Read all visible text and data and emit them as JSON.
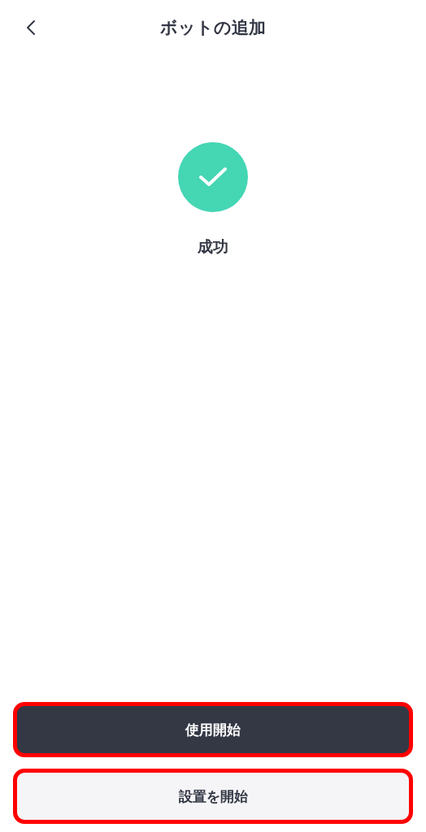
{
  "header": {
    "title": "ボットの追加"
  },
  "status": {
    "kind": "success",
    "label": "成功"
  },
  "buttons": [
    {
      "label": "使用開始",
      "kind": "primary",
      "highlighted": true
    },
    {
      "label": "設置を開始",
      "kind": "secondary",
      "highlighted": true
    }
  ]
}
